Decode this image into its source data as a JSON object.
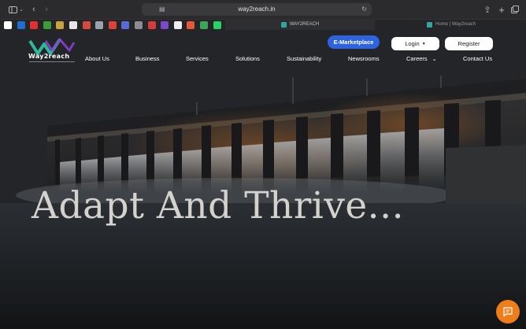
{
  "browser": {
    "url": "way2reach.in",
    "tabs": [
      {
        "label": "WAY2REACH",
        "active": true
      },
      {
        "label": "Home | Way2reach",
        "active": false
      }
    ],
    "bookmark_colors": [
      "#ffffff",
      "#1f6fd1",
      "#e0312c",
      "#3a9d3a",
      "#c8a23a",
      "#e6e6e6",
      "#d54a3a",
      "#9aa3ad",
      "#d9433a",
      "#5a6bd6",
      "#8c8c94",
      "#d23c3c",
      "#7a49c6",
      "#eeeeee",
      "#e35a3a",
      "#3ca65a",
      "#25d366"
    ]
  },
  "site": {
    "logo_text": "Way2reach",
    "buttons": {
      "marketplace": "E-Marketplace",
      "login": "Login",
      "register": "Register"
    },
    "nav": [
      "About Us",
      "Business",
      "Services",
      "Solutions",
      "Sustainability",
      "Newsrooms",
      "Careers",
      "Contact Us"
    ],
    "headline": "Adapt And Thrive...",
    "colors": {
      "accent_blue": "#2e63e0",
      "chat_orange": "#ef7d1a",
      "logo_green": "#2fb89a",
      "logo_purple": "#8b3fd0"
    }
  }
}
